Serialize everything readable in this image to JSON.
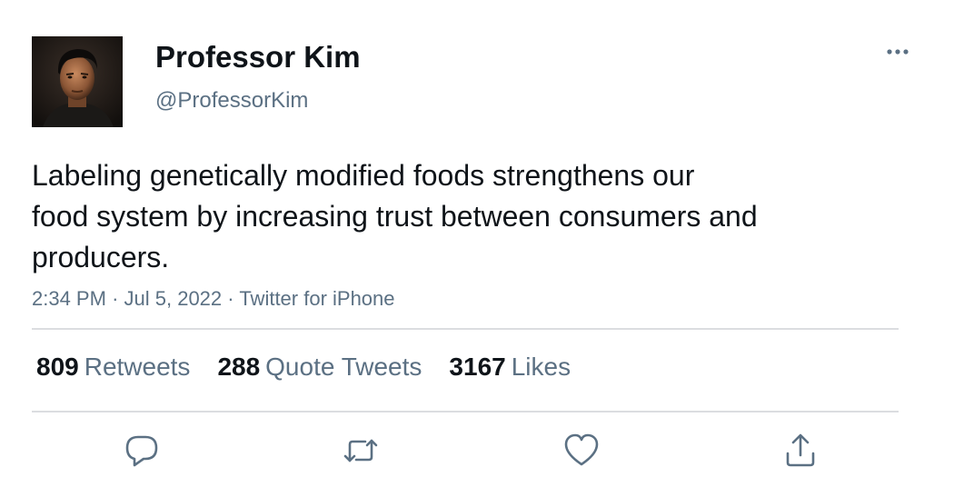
{
  "user": {
    "display_name": "Professor Kim",
    "handle": "@ProfessorKim"
  },
  "tweet": {
    "text": "Labeling genetically modified foods strengthens our\nfood system by increasing trust between consumers and\nproducers.",
    "time": "2:34 PM",
    "date": "Jul 5, 2022",
    "source": "Twitter for iPhone",
    "separator": "·"
  },
  "stats": {
    "retweets": {
      "count": "809",
      "label": "Retweets"
    },
    "quote_tweets": {
      "count": "288",
      "label": "Quote Tweets"
    },
    "likes": {
      "count": "3167",
      "label": "Likes"
    }
  },
  "icons": {
    "more": "more-horizontal-icon",
    "reply": "reply-icon",
    "retweet": "retweet-icon",
    "like": "heart-icon",
    "share": "share-icon"
  },
  "colors": {
    "text_primary": "#0f1419",
    "text_secondary": "#5b7083",
    "divider": "#dbdde0"
  }
}
